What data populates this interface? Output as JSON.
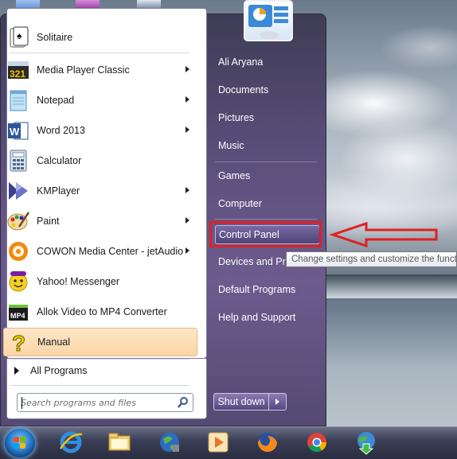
{
  "programs": [
    {
      "label": "Solitaire",
      "icon": "solitaire-icon",
      "submenu": false
    },
    {
      "label": "Media Player Classic",
      "icon": "media-player-classic-icon",
      "submenu": true
    },
    {
      "label": "Notepad",
      "icon": "notepad-icon",
      "submenu": true
    },
    {
      "label": "Word 2013",
      "icon": "word-icon",
      "submenu": true
    },
    {
      "label": "Calculator",
      "icon": "calculator-icon",
      "submenu": false
    },
    {
      "label": "KMPlayer",
      "icon": "kmplayer-icon",
      "submenu": true
    },
    {
      "label": "Paint",
      "icon": "paint-icon",
      "submenu": true
    },
    {
      "label": "COWON Media Center - jetAudio",
      "icon": "jetaudio-icon",
      "submenu": true
    },
    {
      "label": "Yahoo! Messenger",
      "icon": "yahoo-messenger-icon",
      "submenu": false
    },
    {
      "label": "Allok Video to MP4 Converter",
      "icon": "mp4-converter-icon",
      "submenu": false
    },
    {
      "label": "Manual",
      "icon": "help-manual-icon",
      "submenu": false,
      "highlighted": true
    }
  ],
  "all_programs": "All Programs",
  "search": {
    "placeholder": "Search programs and files"
  },
  "right_links": [
    {
      "label": "Ali Aryana"
    },
    {
      "label": "Documents"
    },
    {
      "label": "Pictures"
    },
    {
      "label": "Music"
    },
    {
      "label": "Games"
    },
    {
      "label": "Computer"
    },
    {
      "label": "Control Panel",
      "highlighted": true
    },
    {
      "label": "Devices and Printers"
    },
    {
      "label": "Default Programs"
    },
    {
      "label": "Help and Support"
    }
  ],
  "shutdown_label": "Shut down",
  "tooltip": "Change settings and customize the functionality of this computer.",
  "taskbar_icons": [
    "internet-explorer-icon",
    "file-explorer-icon",
    "network-globe-icon",
    "media-player-icon",
    "firefox-icon",
    "chrome-icon",
    "download-manager-icon"
  ],
  "colors": {
    "highlight_annotation": "#e02020",
    "menu_purple": "#5b4f7c",
    "program_hover": "#fbd6a6"
  }
}
